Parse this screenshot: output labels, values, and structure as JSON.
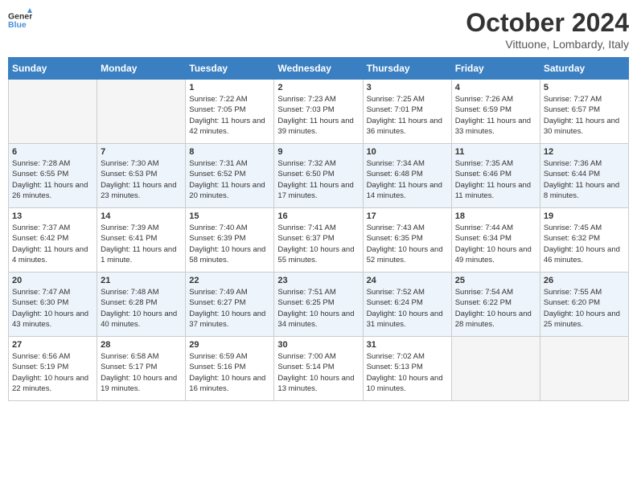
{
  "header": {
    "logo": {
      "line1": "General",
      "line2": "Blue"
    },
    "title": "October 2024",
    "location": "Vittuone, Lombardy, Italy"
  },
  "weekdays": [
    "Sunday",
    "Monday",
    "Tuesday",
    "Wednesday",
    "Thursday",
    "Friday",
    "Saturday"
  ],
  "weeks": [
    [
      {
        "day": "",
        "sunrise": "",
        "sunset": "",
        "daylight": ""
      },
      {
        "day": "",
        "sunrise": "",
        "sunset": "",
        "daylight": ""
      },
      {
        "day": "1",
        "sunrise": "Sunrise: 7:22 AM",
        "sunset": "Sunset: 7:05 PM",
        "daylight": "Daylight: 11 hours and 42 minutes."
      },
      {
        "day": "2",
        "sunrise": "Sunrise: 7:23 AM",
        "sunset": "Sunset: 7:03 PM",
        "daylight": "Daylight: 11 hours and 39 minutes."
      },
      {
        "day": "3",
        "sunrise": "Sunrise: 7:25 AM",
        "sunset": "Sunset: 7:01 PM",
        "daylight": "Daylight: 11 hours and 36 minutes."
      },
      {
        "day": "4",
        "sunrise": "Sunrise: 7:26 AM",
        "sunset": "Sunset: 6:59 PM",
        "daylight": "Daylight: 11 hours and 33 minutes."
      },
      {
        "day": "5",
        "sunrise": "Sunrise: 7:27 AM",
        "sunset": "Sunset: 6:57 PM",
        "daylight": "Daylight: 11 hours and 30 minutes."
      }
    ],
    [
      {
        "day": "6",
        "sunrise": "Sunrise: 7:28 AM",
        "sunset": "Sunset: 6:55 PM",
        "daylight": "Daylight: 11 hours and 26 minutes."
      },
      {
        "day": "7",
        "sunrise": "Sunrise: 7:30 AM",
        "sunset": "Sunset: 6:53 PM",
        "daylight": "Daylight: 11 hours and 23 minutes."
      },
      {
        "day": "8",
        "sunrise": "Sunrise: 7:31 AM",
        "sunset": "Sunset: 6:52 PM",
        "daylight": "Daylight: 11 hours and 20 minutes."
      },
      {
        "day": "9",
        "sunrise": "Sunrise: 7:32 AM",
        "sunset": "Sunset: 6:50 PM",
        "daylight": "Daylight: 11 hours and 17 minutes."
      },
      {
        "day": "10",
        "sunrise": "Sunrise: 7:34 AM",
        "sunset": "Sunset: 6:48 PM",
        "daylight": "Daylight: 11 hours and 14 minutes."
      },
      {
        "day": "11",
        "sunrise": "Sunrise: 7:35 AM",
        "sunset": "Sunset: 6:46 PM",
        "daylight": "Daylight: 11 hours and 11 minutes."
      },
      {
        "day": "12",
        "sunrise": "Sunrise: 7:36 AM",
        "sunset": "Sunset: 6:44 PM",
        "daylight": "Daylight: 11 hours and 8 minutes."
      }
    ],
    [
      {
        "day": "13",
        "sunrise": "Sunrise: 7:37 AM",
        "sunset": "Sunset: 6:42 PM",
        "daylight": "Daylight: 11 hours and 4 minutes."
      },
      {
        "day": "14",
        "sunrise": "Sunrise: 7:39 AM",
        "sunset": "Sunset: 6:41 PM",
        "daylight": "Daylight: 11 hours and 1 minute."
      },
      {
        "day": "15",
        "sunrise": "Sunrise: 7:40 AM",
        "sunset": "Sunset: 6:39 PM",
        "daylight": "Daylight: 10 hours and 58 minutes."
      },
      {
        "day": "16",
        "sunrise": "Sunrise: 7:41 AM",
        "sunset": "Sunset: 6:37 PM",
        "daylight": "Daylight: 10 hours and 55 minutes."
      },
      {
        "day": "17",
        "sunrise": "Sunrise: 7:43 AM",
        "sunset": "Sunset: 6:35 PM",
        "daylight": "Daylight: 10 hours and 52 minutes."
      },
      {
        "day": "18",
        "sunrise": "Sunrise: 7:44 AM",
        "sunset": "Sunset: 6:34 PM",
        "daylight": "Daylight: 10 hours and 49 minutes."
      },
      {
        "day": "19",
        "sunrise": "Sunrise: 7:45 AM",
        "sunset": "Sunset: 6:32 PM",
        "daylight": "Daylight: 10 hours and 46 minutes."
      }
    ],
    [
      {
        "day": "20",
        "sunrise": "Sunrise: 7:47 AM",
        "sunset": "Sunset: 6:30 PM",
        "daylight": "Daylight: 10 hours and 43 minutes."
      },
      {
        "day": "21",
        "sunrise": "Sunrise: 7:48 AM",
        "sunset": "Sunset: 6:28 PM",
        "daylight": "Daylight: 10 hours and 40 minutes."
      },
      {
        "day": "22",
        "sunrise": "Sunrise: 7:49 AM",
        "sunset": "Sunset: 6:27 PM",
        "daylight": "Daylight: 10 hours and 37 minutes."
      },
      {
        "day": "23",
        "sunrise": "Sunrise: 7:51 AM",
        "sunset": "Sunset: 6:25 PM",
        "daylight": "Daylight: 10 hours and 34 minutes."
      },
      {
        "day": "24",
        "sunrise": "Sunrise: 7:52 AM",
        "sunset": "Sunset: 6:24 PM",
        "daylight": "Daylight: 10 hours and 31 minutes."
      },
      {
        "day": "25",
        "sunrise": "Sunrise: 7:54 AM",
        "sunset": "Sunset: 6:22 PM",
        "daylight": "Daylight: 10 hours and 28 minutes."
      },
      {
        "day": "26",
        "sunrise": "Sunrise: 7:55 AM",
        "sunset": "Sunset: 6:20 PM",
        "daylight": "Daylight: 10 hours and 25 minutes."
      }
    ],
    [
      {
        "day": "27",
        "sunrise": "Sunrise: 6:56 AM",
        "sunset": "Sunset: 5:19 PM",
        "daylight": "Daylight: 10 hours and 22 minutes."
      },
      {
        "day": "28",
        "sunrise": "Sunrise: 6:58 AM",
        "sunset": "Sunset: 5:17 PM",
        "daylight": "Daylight: 10 hours and 19 minutes."
      },
      {
        "day": "29",
        "sunrise": "Sunrise: 6:59 AM",
        "sunset": "Sunset: 5:16 PM",
        "daylight": "Daylight: 10 hours and 16 minutes."
      },
      {
        "day": "30",
        "sunrise": "Sunrise: 7:00 AM",
        "sunset": "Sunset: 5:14 PM",
        "daylight": "Daylight: 10 hours and 13 minutes."
      },
      {
        "day": "31",
        "sunrise": "Sunrise: 7:02 AM",
        "sunset": "Sunset: 5:13 PM",
        "daylight": "Daylight: 10 hours and 10 minutes."
      },
      {
        "day": "",
        "sunrise": "",
        "sunset": "",
        "daylight": ""
      },
      {
        "day": "",
        "sunrise": "",
        "sunset": "",
        "daylight": ""
      }
    ]
  ]
}
